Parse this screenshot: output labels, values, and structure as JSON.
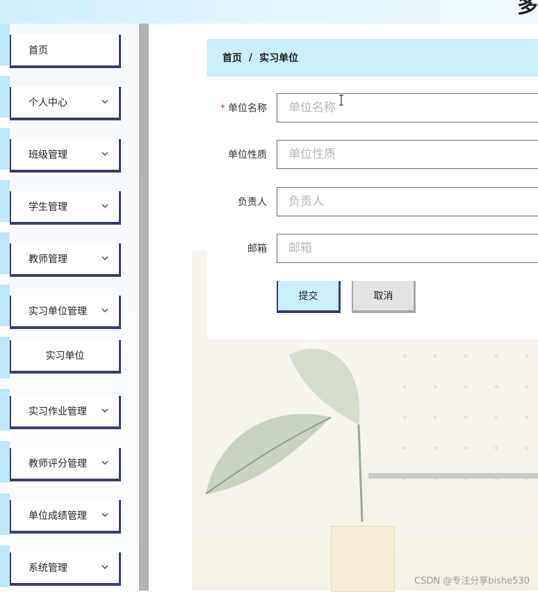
{
  "header": {
    "title_glyph": "多"
  },
  "sidebar": {
    "items": [
      {
        "label": "首页",
        "has_chevron": false
      },
      {
        "label": "个人中心",
        "has_chevron": true
      },
      {
        "label": "班级管理",
        "has_chevron": true
      },
      {
        "label": "学生管理",
        "has_chevron": true
      },
      {
        "label": "教师管理",
        "has_chevron": true
      },
      {
        "label": "实习单位管理",
        "has_chevron": true
      },
      {
        "label": "实习单位",
        "has_chevron": false,
        "submenu": true
      },
      {
        "label": "实习作业管理",
        "has_chevron": true
      },
      {
        "label": "教师评分管理",
        "has_chevron": true
      },
      {
        "label": "单位成绩管理",
        "has_chevron": true
      },
      {
        "label": "系统管理",
        "has_chevron": true
      }
    ]
  },
  "breadcrumb": {
    "home": "首页",
    "separator": "/",
    "current": "实习单位"
  },
  "form": {
    "fields": [
      {
        "label": "单位名称",
        "required": true,
        "placeholder": "单位名称",
        "value": ""
      },
      {
        "label": "单位性质",
        "required": false,
        "placeholder": "单位性质",
        "value": ""
      },
      {
        "label": "负责人",
        "required": false,
        "placeholder": "负责人",
        "value": ""
      },
      {
        "label": "邮箱",
        "required": false,
        "placeholder": "邮箱",
        "value": ""
      }
    ],
    "required_mark": "*",
    "submit_label": "提交",
    "cancel_label": "取消"
  },
  "watermark": "CSDN @专注分享bishe530",
  "colors": {
    "accent_light_blue": "#cbeefb",
    "border_navy": "#3a3e6c",
    "required_red": "#e03030"
  }
}
